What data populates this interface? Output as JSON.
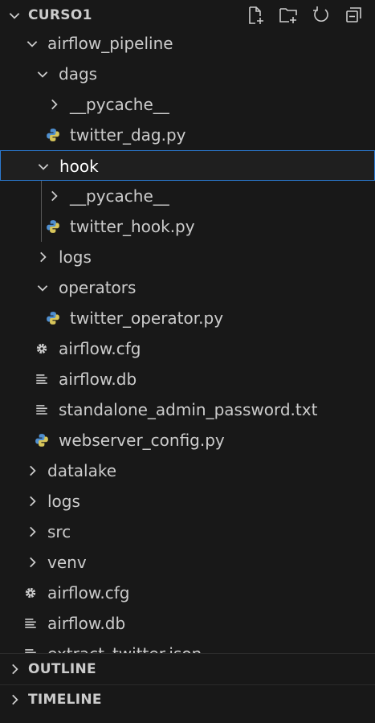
{
  "explorer": {
    "root_label": "CURSO1",
    "actions": [
      {
        "name": "new-file-icon"
      },
      {
        "name": "new-folder-icon"
      },
      {
        "name": "refresh-icon"
      },
      {
        "name": "collapse-all-icon"
      }
    ]
  },
  "tree": [
    {
      "label": "airflow_pipeline",
      "kind": "folder",
      "expanded": true,
      "depth": 1
    },
    {
      "label": "dags",
      "kind": "folder",
      "expanded": true,
      "depth": 2
    },
    {
      "label": "__pycache__",
      "kind": "folder",
      "expanded": false,
      "depth": 3
    },
    {
      "label": "twitter_dag.py",
      "kind": "python",
      "depth": 3
    },
    {
      "label": "hook",
      "kind": "folder",
      "expanded": true,
      "depth": 2,
      "selected": true
    },
    {
      "label": "__pycache__",
      "kind": "folder",
      "expanded": false,
      "depth": 3
    },
    {
      "label": "twitter_hook.py",
      "kind": "python",
      "depth": 3
    },
    {
      "label": "logs",
      "kind": "folder",
      "expanded": false,
      "depth": 2
    },
    {
      "label": "operators",
      "kind": "folder",
      "expanded": true,
      "depth": 2
    },
    {
      "label": "twitter_operator.py",
      "kind": "python",
      "depth": 3
    },
    {
      "label": "airflow.cfg",
      "kind": "config",
      "depth": 2
    },
    {
      "label": "airflow.db",
      "kind": "text",
      "depth": 2
    },
    {
      "label": "standalone_admin_password.txt",
      "kind": "text",
      "depth": 2
    },
    {
      "label": "webserver_config.py",
      "kind": "python",
      "depth": 2
    },
    {
      "label": "datalake",
      "kind": "folder",
      "expanded": false,
      "depth": 1
    },
    {
      "label": "logs",
      "kind": "folder",
      "expanded": false,
      "depth": 1
    },
    {
      "label": "src",
      "kind": "folder",
      "expanded": false,
      "depth": 1
    },
    {
      "label": "venv",
      "kind": "folder",
      "expanded": false,
      "depth": 1
    },
    {
      "label": "airflow.cfg",
      "kind": "config",
      "depth": 1
    },
    {
      "label": "airflow.db",
      "kind": "text",
      "depth": 1
    },
    {
      "label": "extract_twitter.json",
      "kind": "text",
      "depth": 1
    }
  ],
  "sections": {
    "outline": "OUTLINE",
    "timeline": "TIMELINE"
  },
  "colors": {
    "background": "#181818",
    "selection_border": "#2b79d0",
    "python_blue": "#4f8fd0",
    "python_yellow": "#d7c55a",
    "text": "#cccccc"
  }
}
